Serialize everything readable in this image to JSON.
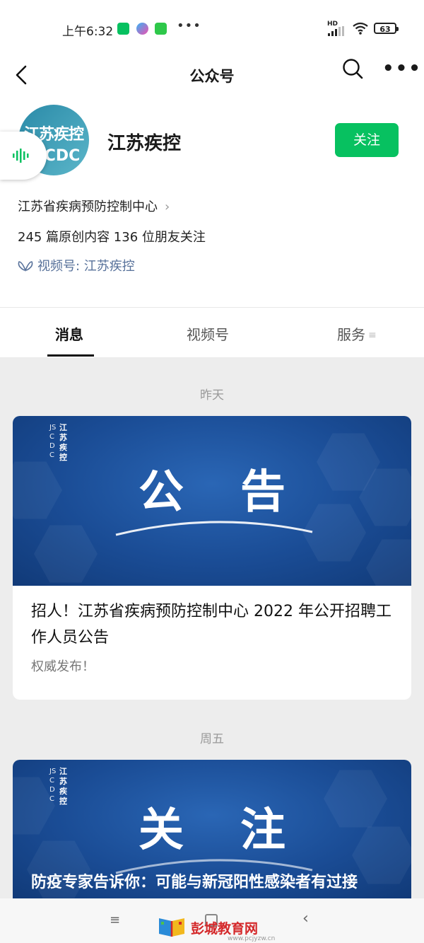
{
  "status": {
    "time": "上午6:32",
    "dots": "•••",
    "network_label": "HD",
    "battery": "63"
  },
  "nav": {
    "title": "公众号",
    "more": "•••"
  },
  "profile": {
    "avatar_line1": "江苏疾控",
    "avatar_line2": "JSCDC",
    "name": "江苏疾控",
    "follow_label": "关注",
    "org": "江苏省疾病预防控制中心",
    "org_chevron": "›",
    "stats": "245 篇原创内容  136 位朋友关注",
    "channel": "视频号: 江苏疾控"
  },
  "tabs": [
    {
      "label": "消息"
    },
    {
      "label": "视频号"
    },
    {
      "label": "服务"
    }
  ],
  "feed": {
    "date1": "昨天",
    "post1": {
      "logo_letters": "JSCDC",
      "logo_name": "江苏疾控",
      "banner_text": "公告",
      "title": "招人！江苏省疾病预防控制中心 2022 年公开招聘工作人员公告",
      "subtitle": "权威发布！"
    },
    "date2": "周五",
    "post2": {
      "logo_letters": "JSCDC",
      "logo_name": "江苏疾控",
      "banner_text": "关注",
      "title": "防疫专家告诉你：可能与新冠阳性感染者有过接"
    }
  },
  "bottom": {
    "nav_menu": "≡",
    "nav_back": "‹"
  },
  "watermark": {
    "text": "彭城教育网",
    "url": "www.pcjyzw.cn"
  },
  "colors": {
    "accent": "#07c160",
    "channel": "#57719a",
    "banner": "#1a4c95"
  }
}
